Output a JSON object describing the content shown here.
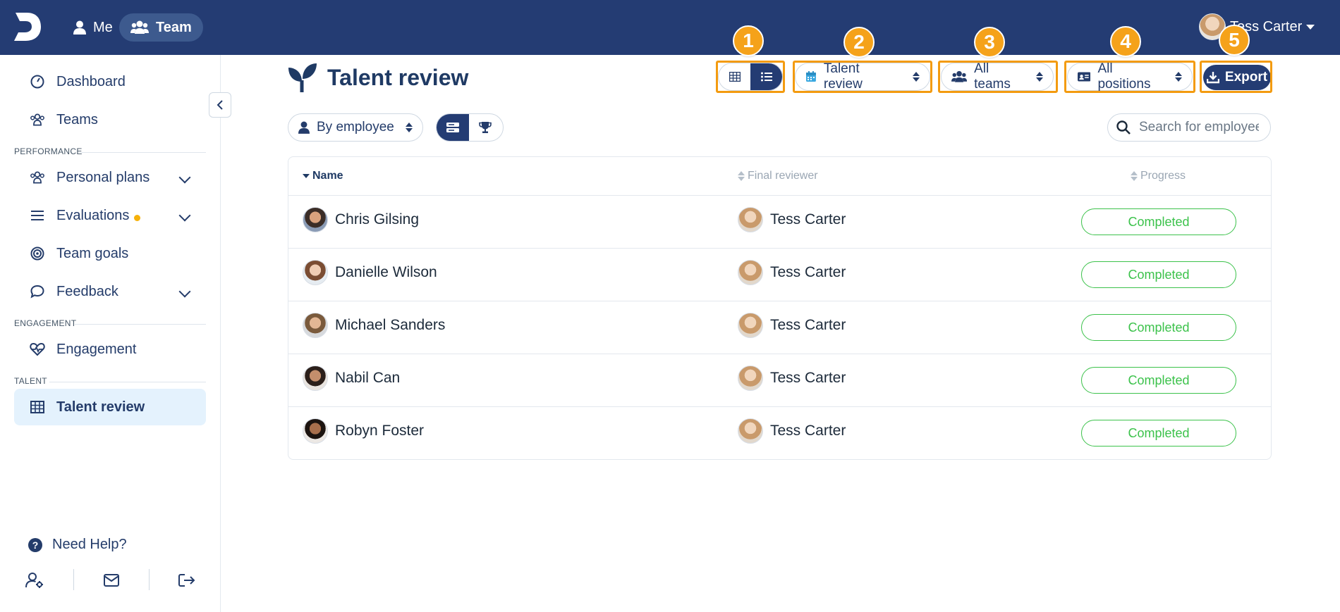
{
  "app": {
    "logo_letter": "D"
  },
  "topnav": {
    "me_label": "Me",
    "team_label": "Team",
    "user_name": "Tess Carter"
  },
  "sidebar": {
    "items_top": [
      {
        "label": "Dashboard",
        "icon": "dashboard-icon"
      },
      {
        "label": "Teams",
        "icon": "users-icon"
      }
    ],
    "section_performance": "PERFORMANCE",
    "performance_items": [
      {
        "label": "Personal plans",
        "icon": "users-icon",
        "expandable": true
      },
      {
        "label": "Evaluations",
        "icon": "list-icon",
        "expandable": true,
        "notification_dot": true
      },
      {
        "label": "Team goals",
        "icon": "target-icon"
      },
      {
        "label": "Feedback",
        "icon": "chat-icon",
        "expandable": true
      }
    ],
    "section_engagement": "ENGAGEMENT",
    "engagement_items": [
      {
        "label": "Engagement",
        "icon": "heartbeat-icon"
      }
    ],
    "section_talent": "TALENT",
    "talent_items": [
      {
        "label": "Talent review",
        "icon": "grid-icon",
        "active": true
      }
    ],
    "help_label": "Need Help?"
  },
  "page": {
    "title": "Talent review",
    "filters": {
      "cycle_label": "Talent review",
      "teams_label": "All teams",
      "positions_label": "All positions",
      "export_label": "Export",
      "group_by_label": "By employee"
    },
    "badges": [
      "1",
      "2",
      "3",
      "4",
      "5"
    ],
    "search": {
      "placeholder": "Search for employee",
      "value": ""
    },
    "accent_color": "#243c73",
    "highlight_color": "#f39b10"
  },
  "table": {
    "columns": [
      "Name",
      "Final reviewer",
      "Progress"
    ],
    "rows": [
      {
        "name": "Chris Gilsing",
        "reviewer": "Tess Carter",
        "progress": "Completed"
      },
      {
        "name": "Danielle Wilson",
        "reviewer": "Tess Carter",
        "progress": "Completed"
      },
      {
        "name": "Michael Sanders",
        "reviewer": "Tess Carter",
        "progress": "Completed"
      },
      {
        "name": "Nabil Can",
        "reviewer": "Tess Carter",
        "progress": "Completed"
      },
      {
        "name": "Robyn Foster",
        "reviewer": "Tess Carter",
        "progress": "Completed"
      }
    ],
    "status_color": "#3cc24b"
  }
}
